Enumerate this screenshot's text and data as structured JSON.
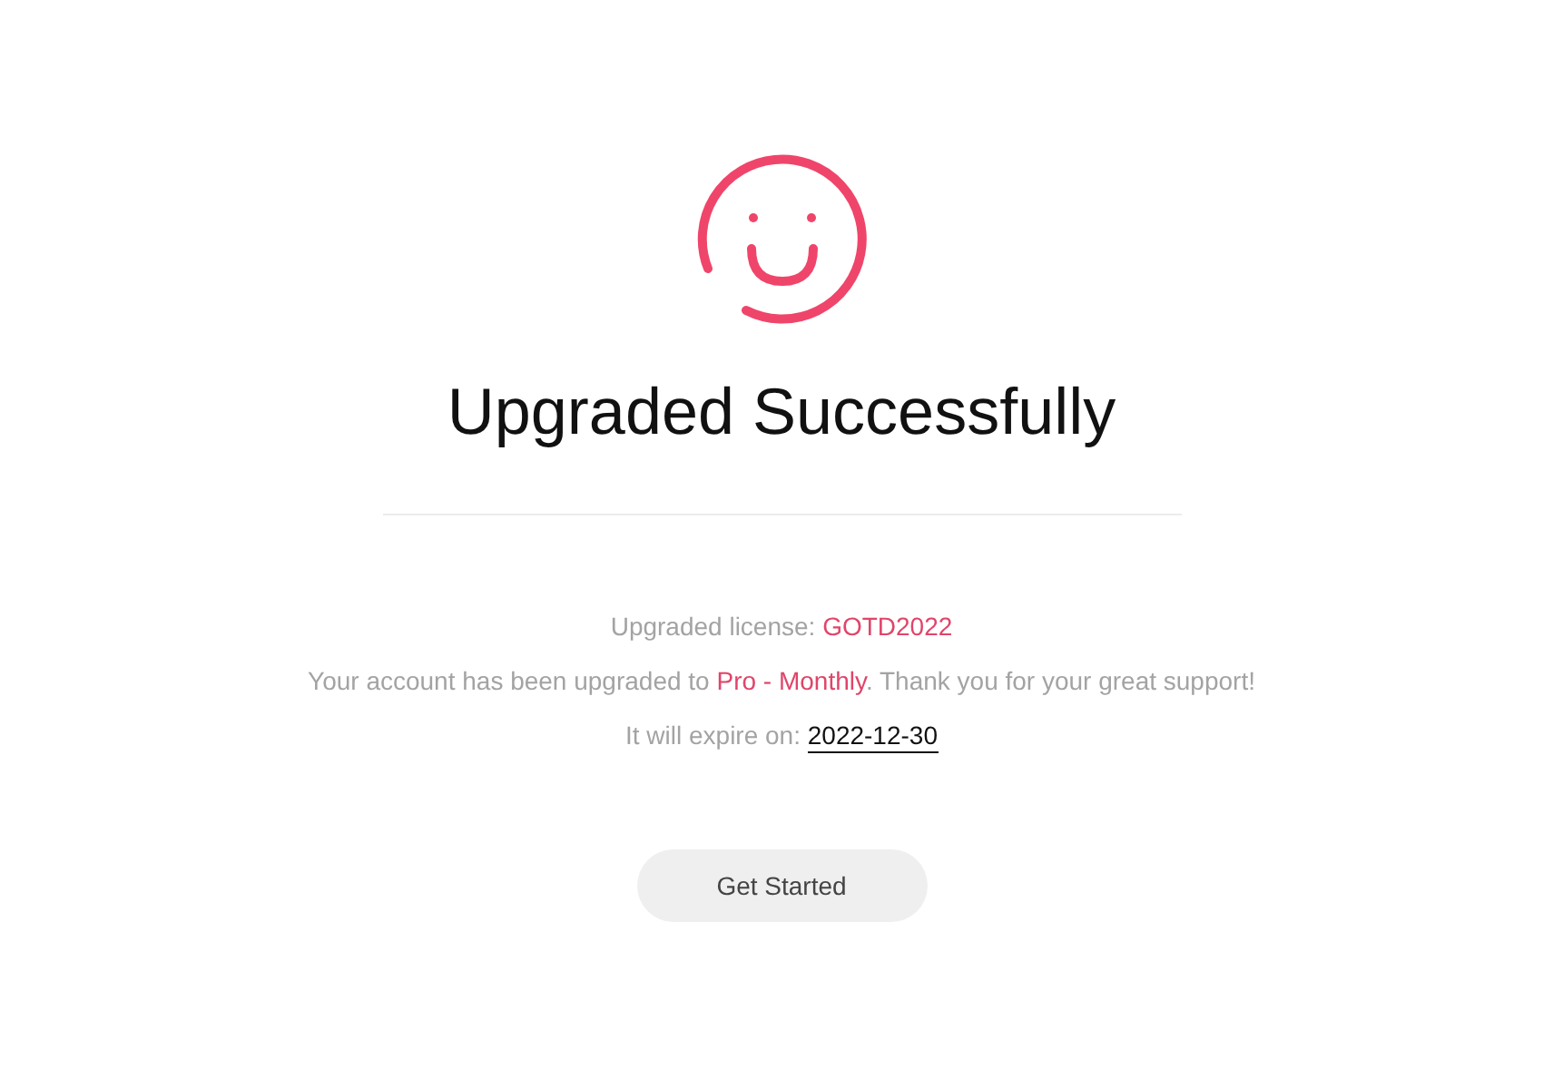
{
  "title": "Upgraded Successfully",
  "details": [
    {
      "segments": [
        {
          "kind": "plain",
          "text": "Upgraded license: "
        },
        {
          "kind": "accent",
          "text": "GOTD2022"
        }
      ]
    },
    {
      "segments": [
        {
          "kind": "plain",
          "text": "Your account has been upgraded to "
        },
        {
          "kind": "accent",
          "text": "Pro - Monthly"
        },
        {
          "kind": "plain",
          "text": ". Thank you for your great support!"
        }
      ]
    },
    {
      "segments": [
        {
          "kind": "plain",
          "text": "It will expire on: "
        },
        {
          "kind": "date",
          "text": "2022-12-30"
        }
      ]
    }
  ],
  "button": {
    "label": "Get Started"
  }
}
